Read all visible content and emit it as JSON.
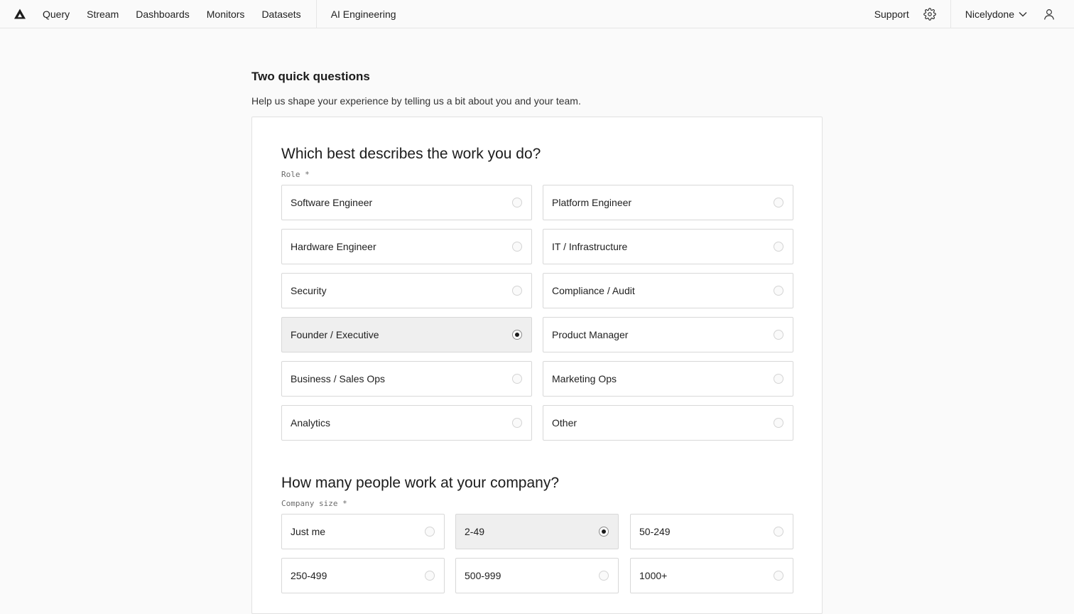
{
  "topbar": {
    "nav": [
      {
        "id": "query",
        "label": "Query"
      },
      {
        "id": "stream",
        "label": "Stream"
      },
      {
        "id": "dashboards",
        "label": "Dashboards"
      },
      {
        "id": "monitors",
        "label": "Monitors"
      },
      {
        "id": "datasets",
        "label": "Datasets"
      }
    ],
    "ai_label": "AI Engineering",
    "support_label": "Support",
    "org_name": "Nicelydone",
    "icons": {
      "logo": "axiom-logo-icon",
      "settings": "gear-icon",
      "org_menu": "chevron-down-icon",
      "user": "user-icon"
    }
  },
  "page": {
    "title": "Two quick questions",
    "subtitle": "Help us shape your experience by telling us a bit about you and your team."
  },
  "questions": {
    "role": {
      "heading": "Which best describes the work you do?",
      "label": "Role *",
      "selected": "Founder / Executive",
      "options": [
        "Software Engineer",
        "Platform Engineer",
        "Hardware Engineer",
        "IT / Infrastructure",
        "Security",
        "Compliance / Audit",
        "Founder / Executive",
        "Product Manager",
        "Business / Sales Ops",
        "Marketing Ops",
        "Analytics",
        "Other"
      ]
    },
    "size": {
      "heading": "How many people work at your company?",
      "label": "Company size *",
      "selected": "2-49",
      "options": [
        "Just me",
        "2-49",
        "50-249",
        "250-499",
        "500-999",
        "1000+"
      ]
    }
  },
  "colors": {
    "selected_bg": "#efefef",
    "border": "#d8d8d8",
    "text": "#1c1c1c"
  }
}
